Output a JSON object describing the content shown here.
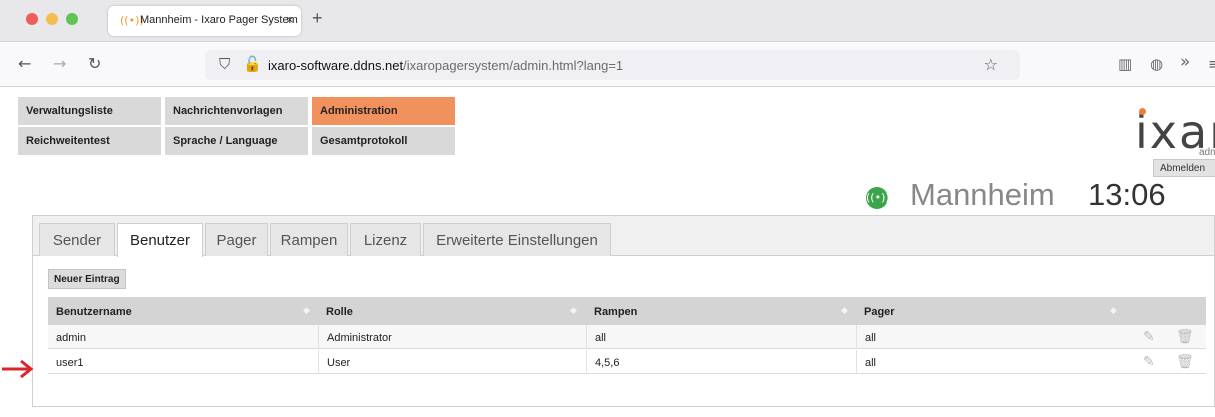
{
  "browser": {
    "tab_title": "Mannheim - Ixaro Pager System",
    "tab_close": "×",
    "new_tab": "+",
    "back": "←",
    "forward": "→",
    "reload": "↻",
    "url_host": "ixaro-software.ddns.net",
    "url_path": "/ixaropagersystem/admin.html?lang=1",
    "bookmark_icon": "☆",
    "overflow": "»"
  },
  "menu": {
    "row1": [
      "Verwaltungsliste",
      "Nachrichtenvorlagen",
      "Administration"
    ],
    "row2": [
      "Reichweitentest",
      "Sprache / Language",
      "Gesamtprotokoll"
    ],
    "active": "Administration",
    "active_color": "#f1925e"
  },
  "header": {
    "logo": "ixarc",
    "admin_label": "admi",
    "logout": "Abmelden"
  },
  "station": {
    "name": "Mannheim",
    "time": "13:06",
    "signal_color": "#3aa54a"
  },
  "tabs": [
    {
      "label": "Sender"
    },
    {
      "label": "Benutzer"
    },
    {
      "label": "Pager"
    },
    {
      "label": "Rampen"
    },
    {
      "label": "Lizenz"
    },
    {
      "label": "Erweiterte Einstellungen"
    }
  ],
  "active_tab": "Benutzer",
  "new_entry": "Neuer Eintrag",
  "table": {
    "columns": [
      "Benutzername",
      "Rolle",
      "Rampen",
      "Pager"
    ],
    "rows": [
      {
        "username": "admin",
        "role": "Administrator",
        "ramps": "all",
        "pager": "all"
      },
      {
        "username": "user1",
        "role": "User",
        "ramps": "4,5,6",
        "pager": "all"
      }
    ]
  },
  "annotation": {
    "arrow_color": "#d9262c"
  }
}
